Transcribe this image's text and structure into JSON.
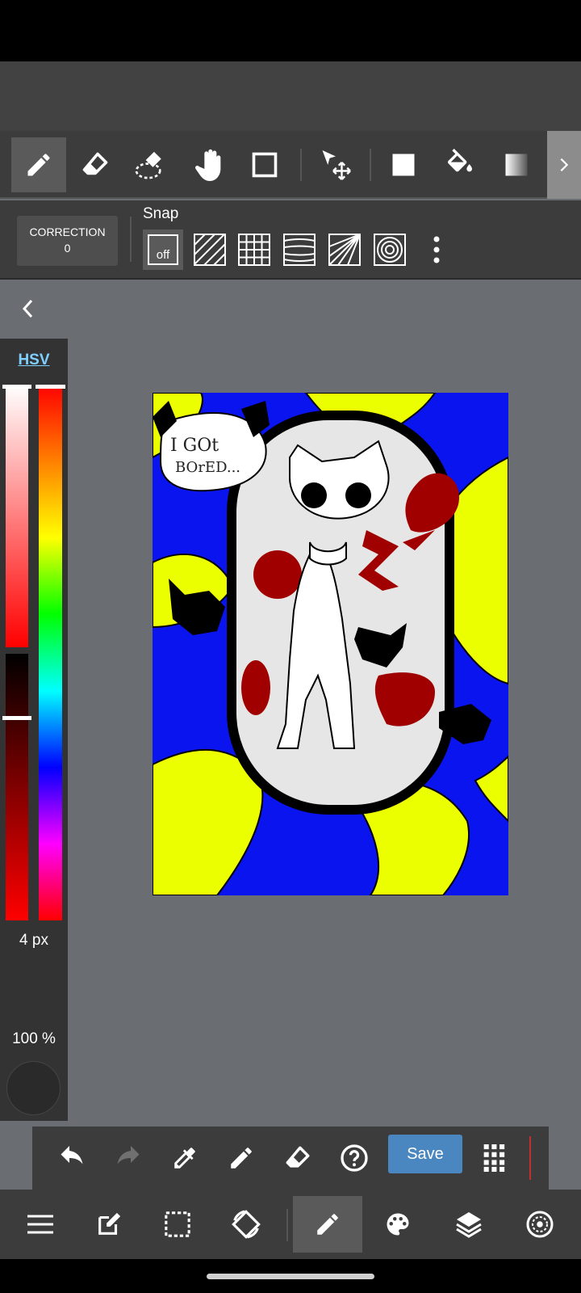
{
  "toolbar": {
    "tools": [
      {
        "name": "pen-tool",
        "icon": "pencil-icon",
        "active": true
      },
      {
        "name": "eraser-tool",
        "icon": "eraser-icon"
      },
      {
        "name": "selection-eraser-tool",
        "icon": "dotted-eraser-icon"
      },
      {
        "name": "hand-tool",
        "icon": "hand-icon"
      },
      {
        "name": "shape-tool",
        "icon": "square-outline-icon"
      },
      {
        "name": "move-tool",
        "icon": "move-arrow-icon"
      },
      {
        "name": "fill-rect-tool",
        "icon": "filled-square-icon"
      },
      {
        "name": "bucket-tool",
        "icon": "paint-bucket-icon"
      },
      {
        "name": "gradient-tool",
        "icon": "gradient-icon"
      }
    ],
    "more_icon": "chevron-right-icon"
  },
  "snap": {
    "correction_label": "CORRECTION",
    "correction_value": "0",
    "label": "Snap",
    "off_label": "off",
    "options": [
      "snap-off",
      "snap-parallel",
      "snap-grid",
      "snap-curve",
      "snap-radial",
      "snap-circle"
    ]
  },
  "color_panel": {
    "mode_label": "HSV",
    "brush_size": "4 px",
    "opacity": "100 %",
    "current_color": "#2a2a2a",
    "hue_position": 0.0,
    "value_position": 0.25
  },
  "bottom_toolbar": {
    "save_label": "Save",
    "icons": [
      "undo-icon",
      "redo-icon",
      "eyedropper-icon",
      "pencil-icon",
      "eraser-icon",
      "help-icon",
      "grid-dots-icon"
    ]
  },
  "canvas": {
    "speech_text_line1": "I GOt",
    "speech_text_line2": "BOrED..."
  },
  "navbar": {
    "items": [
      "menu-icon",
      "edit-icon",
      "selection-icon",
      "rotate-icon",
      "brush-icon",
      "palette-icon",
      "layers-icon",
      "material-icon"
    ],
    "active": "brush-icon"
  },
  "colors": {
    "accent": "#4a86c0",
    "toolbar_bg": "#3c3c3c",
    "canvas_bg": "#6a6d72"
  }
}
